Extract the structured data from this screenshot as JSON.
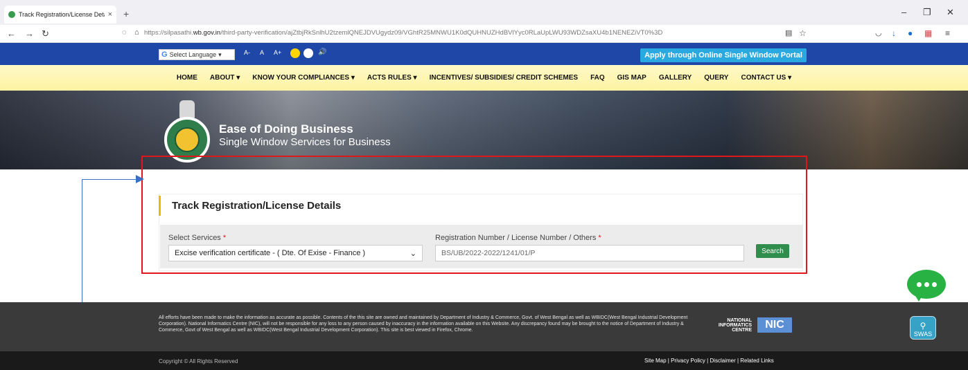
{
  "browser": {
    "tab_title": "Track Registration/License Deta",
    "tab_close": "×",
    "new_tab": "+",
    "url_prefix": "https://silpasathi.",
    "url_domain": "wb.gov.in",
    "url_rest": "/third-party-verification/ajZtbjRkSnlhU2tzemlQNEJDVUgydz09/VGhtR25MNWU1K0dQUHNUZHdBVlYyc0RLaUpLWU93WDZsaXU4b1NENEZiVT0%3D",
    "icons": [
      "back-icon",
      "forward-icon",
      "reload-icon",
      "shield-icon",
      "lock-icon",
      "reader-icon",
      "star-icon",
      "pocket-icon",
      "download-icon",
      "extension-icon",
      "menu-icon"
    ]
  },
  "topstrip": {
    "language_label": "Select Language",
    "font_small": "A-",
    "font_normal": "A",
    "font_large": "A+",
    "apply_button": "Apply through Online Single Window Portal"
  },
  "menu": {
    "items": [
      "HOME",
      "ABOUT ▾",
      "KNOW YOUR COMPLIANCES ▾",
      "ACTS RULES ▾",
      "INCENTIVES/ SUBSIDIES/ CREDIT SCHEMES",
      "FAQ",
      "GIS MAP",
      "GALLERY",
      "QUERY",
      "CONTACT US ▾"
    ]
  },
  "banner": {
    "title": "Ease of Doing Business",
    "subtitle": "Single Window Services for Business"
  },
  "form": {
    "heading": "Track Registration/License Details",
    "service_label": "Select Services",
    "service_value": "Excise verification certificate - ( Dte. Of Exise - Finance )",
    "reg_label": "Registration Number / License Number / Others",
    "reg_value": "BS/UB/2022-2022/1241/01/P",
    "required_mark": "*",
    "search_button": "Search"
  },
  "footer": {
    "disclaimer": "All efforts have been made to make the information as accurate as possible. Contents of the this site are owned and maintained by Department of Industry & Commerce, Govt. of West Bengal as well as WBIDC(West Bengal Industrial Development Corporation). National Informatics Centre (NIC), will not be responsible for any loss to any person caused by inaccuracy in the information available on this Website. Any discrepancy found may be brought to the notice of Department of Industry & Commerce, Govt of West Bengal as well as WBIDC(West Bengal Industrial Development Corporation). This site is best viewed in Firefox, Chrome.",
    "nic_text": "NATIONAL INFORMATICS CENTRE",
    "nic_logo": "NIC",
    "swas": "SWAS",
    "copyright": "Copyright © All Rights Reserved",
    "links": "Site Map | Privacy Policy | Disclaimer | Related Links"
  },
  "colors": {
    "topstrip": "#1e47a8",
    "apply": "#2aa9e0",
    "highlight": "#e0161b",
    "search": "#2f8e4c",
    "chat": "#27b243"
  }
}
